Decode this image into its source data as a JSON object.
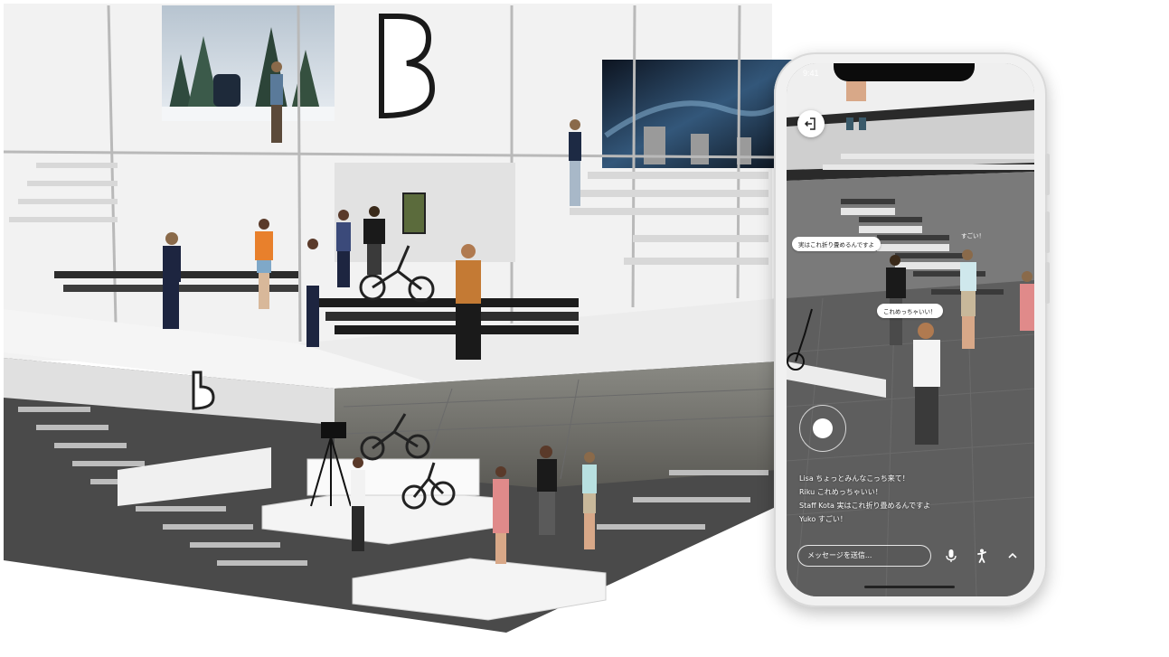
{
  "phone": {
    "status_time": "9:41",
    "bubbles": {
      "staff": "実はこれ折り畳めるんですよ",
      "yuko": "すごい！",
      "riku": "これめっちゃいい！"
    },
    "chat": [
      {
        "name": "Lisa",
        "text": "ちょっとみんなこっち来て！"
      },
      {
        "name": "Riku",
        "text": "これめっちゃいい！"
      },
      {
        "name": "Staff Kota",
        "text": "実はこれ折り畳めるんですよ"
      },
      {
        "name": "Yuko",
        "text": "すごい！"
      }
    ],
    "message_placeholder": "メッセージを送信...",
    "icons": {
      "exit": "exit-icon",
      "mic": "microphone-icon",
      "avatar": "avatar-pose-icon",
      "expand": "chevron-up-icon",
      "joystick": "joystick-icon"
    }
  },
  "store": {
    "logo_text": "B",
    "colors": {
      "floor": "#e9e9e9",
      "dark_floor": "#3a3a3a",
      "frame": "#bdbdbd"
    }
  }
}
